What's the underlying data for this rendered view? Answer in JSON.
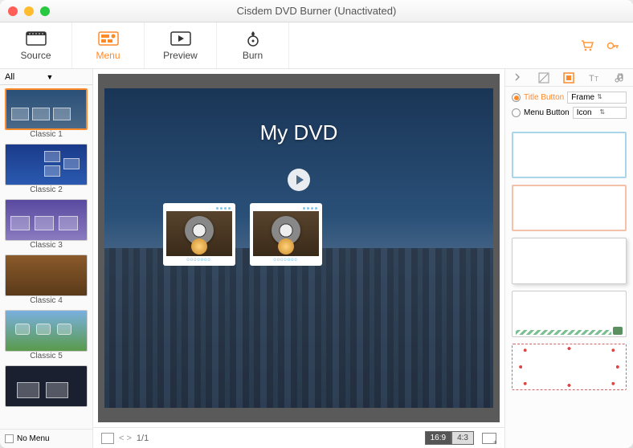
{
  "window": {
    "title": "Cisdem DVD Burner (Unactivated)"
  },
  "tabs": {
    "source": "Source",
    "menu": "Menu",
    "preview": "Preview",
    "burn": "Burn",
    "active": "menu"
  },
  "sidebar": {
    "filter_label": "All",
    "no_menu_label": "No Menu",
    "templates": [
      {
        "label": "Classic 1"
      },
      {
        "label": "Classic 2"
      },
      {
        "label": "Classic 3"
      },
      {
        "label": "Classic 4"
      },
      {
        "label": "Classic 5"
      },
      {
        "label": ""
      }
    ],
    "selected_index": 0
  },
  "canvas": {
    "title": "My DVD",
    "item_placeholder": "ooooooo"
  },
  "footer": {
    "page": "1/1",
    "ratios": [
      "16:9",
      "4:3"
    ],
    "ratio_selected": "16:9"
  },
  "right": {
    "title_button_label": "Title Button",
    "menu_button_label": "Menu Button",
    "title_button_value": "Frame",
    "menu_button_value": "Icon",
    "selected_radio": "title"
  }
}
